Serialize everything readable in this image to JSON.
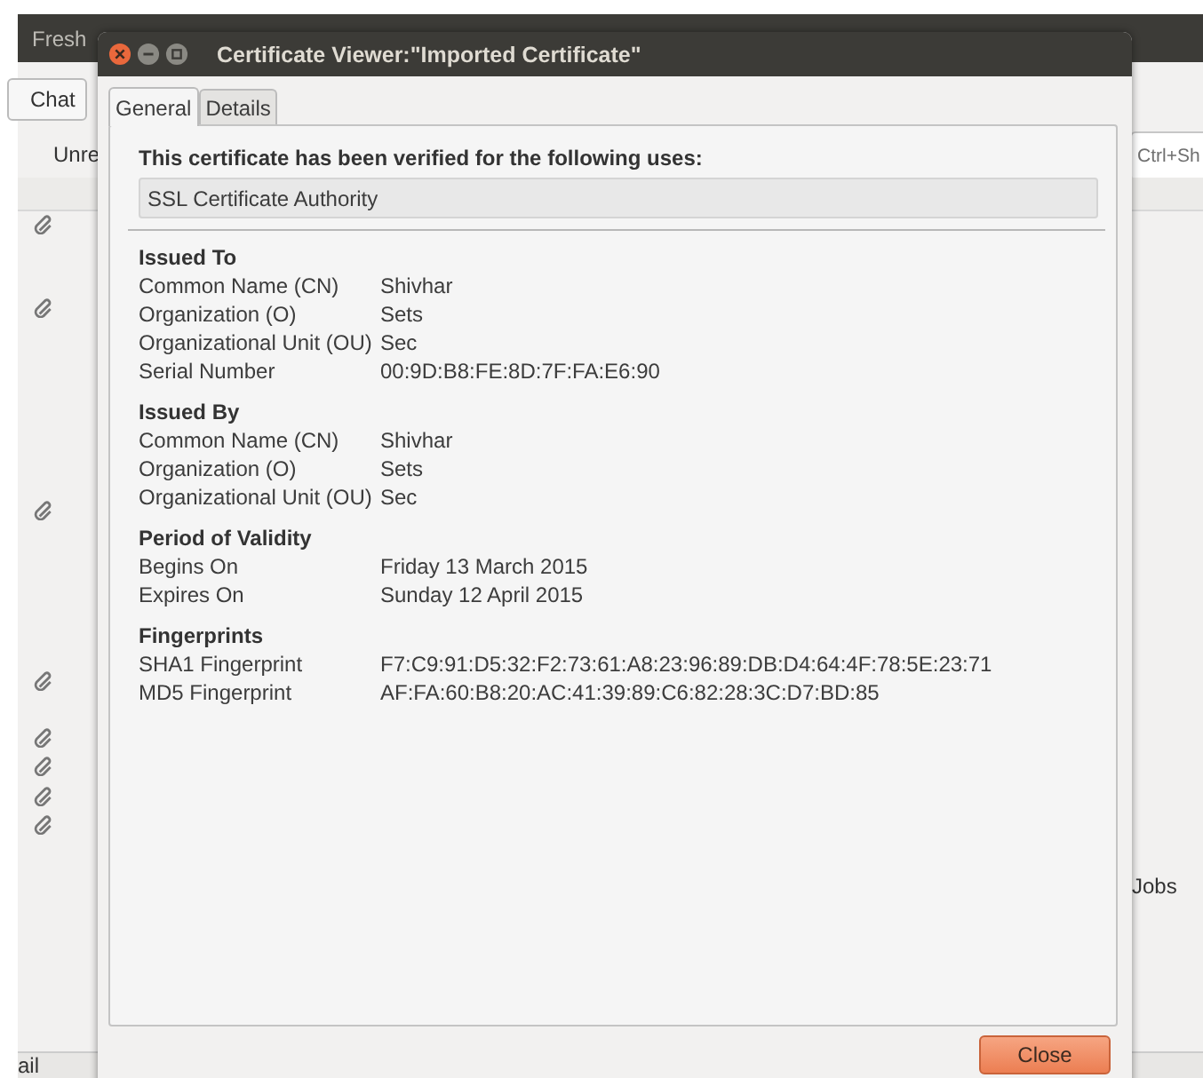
{
  "background_window": {
    "title": "Fresh",
    "toolbar_button": "Chat",
    "filter_label": "Unre",
    "search_hint": "Ctrl+Sh",
    "side_label": "Jobs",
    "status_text": "ail"
  },
  "dialog": {
    "title": "Certificate Viewer:\"Imported Certificate\"",
    "tabs": [
      {
        "label": "General",
        "selected": true
      },
      {
        "label": "Details",
        "selected": false
      }
    ],
    "verified_heading": "This certificate has been verified for the following uses:",
    "uses": [
      "SSL Certificate Authority"
    ],
    "sections": [
      {
        "heading": "Issued To",
        "rows": [
          {
            "label": "Common Name (CN)",
            "value": "Shivhar"
          },
          {
            "label": "Organization (O)",
            "value": "Sets"
          },
          {
            "label": "Organizational Unit (OU)",
            "value": "Sec"
          },
          {
            "label": "Serial Number",
            "value": "00:9D:B8:FE:8D:7F:FA:E6:90"
          }
        ]
      },
      {
        "heading": "Issued By",
        "rows": [
          {
            "label": "Common Name (CN)",
            "value": "Shivhar"
          },
          {
            "label": "Organization (O)",
            "value": "Sets"
          },
          {
            "label": "Organizational Unit (OU)",
            "value": "Sec"
          }
        ]
      },
      {
        "heading": "Period of Validity",
        "rows": [
          {
            "label": "Begins On",
            "value": "Friday 13 March 2015"
          },
          {
            "label": "Expires On",
            "value": "Sunday 12 April 2015"
          }
        ]
      },
      {
        "heading": "Fingerprints",
        "rows": [
          {
            "label": "SHA1 Fingerprint",
            "value": "F7:C9:91:D5:32:F2:73:61:A8:23:96:89:DB:D4:64:4F:78:5E:23:71"
          },
          {
            "label": "MD5 Fingerprint",
            "value": "AF:FA:60:B8:20:AC:41:39:89:C6:82:28:3C:D7:BD:85"
          }
        ]
      }
    ],
    "buttons": [
      "Close"
    ]
  }
}
